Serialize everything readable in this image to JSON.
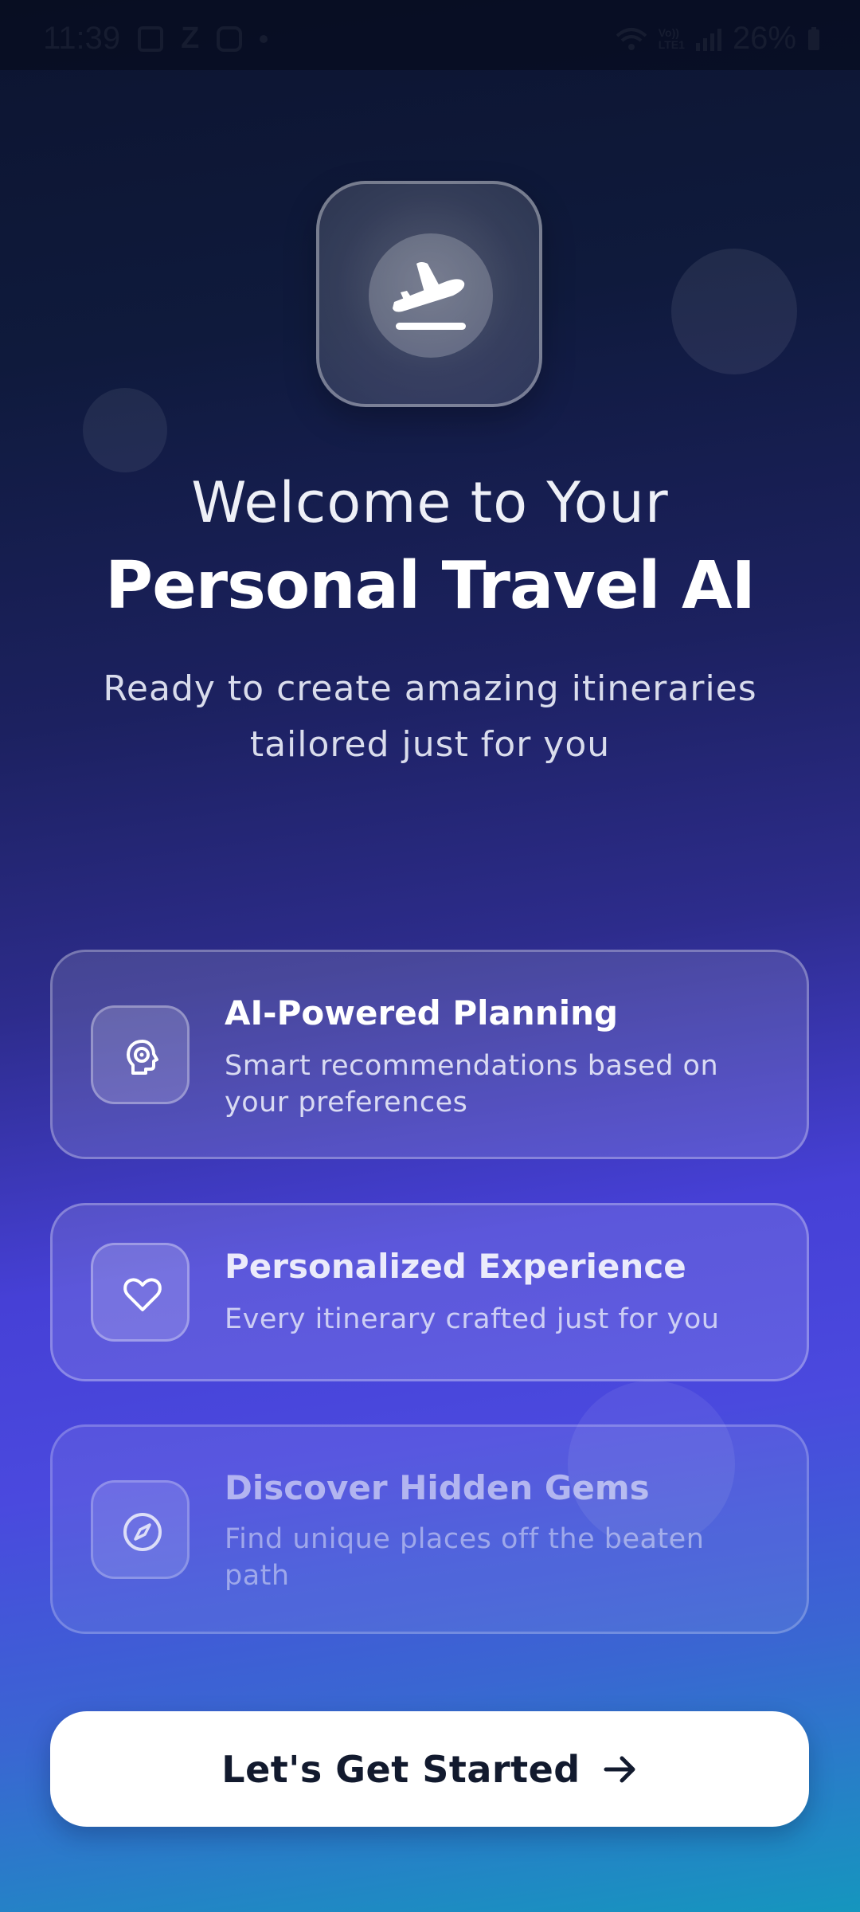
{
  "status_bar": {
    "time": "11:39",
    "notification_icons": [
      "image-icon",
      "z-app-icon",
      "instagram-icon",
      "dot-icon"
    ],
    "network_tag_top": "Vo))",
    "network_tag_bottom": "LTE1",
    "battery": "26%"
  },
  "hero": {
    "logo_icon": "plane-takeoff-icon",
    "welcome": "Welcome to Your",
    "title": "Personal Travel AI",
    "subtitle": "Ready to create amazing itineraries tailored just for you"
  },
  "features": [
    {
      "icon": "ai-brain-icon",
      "title": "AI-Powered Planning",
      "description": "Smart recommendations based on your preferences"
    },
    {
      "icon": "heart-icon",
      "title": "Personalized Experience",
      "description": "Every itinerary crafted just for you"
    },
    {
      "icon": "compass-icon",
      "title": "Discover Hidden Gems",
      "description": "Find unique places off the beaten path"
    }
  ],
  "cta": {
    "label": "Let's Get Started",
    "icon": "arrow-right-icon"
  },
  "colors": {
    "background_top": "#0c1430",
    "background_mid": "#4640d6",
    "background_bottom": "#1596be",
    "cta_background": "#ffffff",
    "cta_text": "#121a2e"
  }
}
